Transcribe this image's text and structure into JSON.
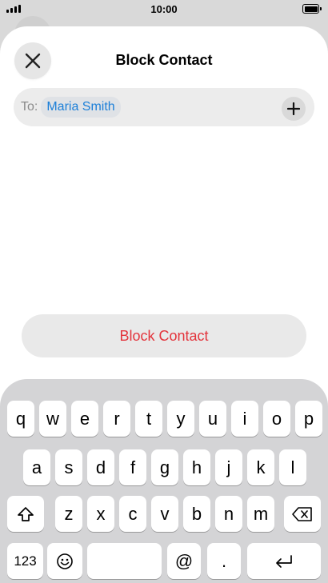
{
  "status_bar": {
    "time": "10:00"
  },
  "header": {
    "title": "Block Contact"
  },
  "compose": {
    "to_label": "To:",
    "recipient": "Maria Smith"
  },
  "action": {
    "block_label": "Block Contact",
    "color": "#e3343c"
  },
  "keyboard": {
    "row1": [
      "q",
      "w",
      "e",
      "r",
      "t",
      "y",
      "u",
      "i",
      "o",
      "p"
    ],
    "row2": [
      "a",
      "s",
      "d",
      "f",
      "g",
      "h",
      "j",
      "k",
      "l"
    ],
    "row3": [
      "z",
      "x",
      "c",
      "v",
      "b",
      "n",
      "m"
    ],
    "numbers_label": "123",
    "at_label": "@",
    "period_label": ".",
    "icons": {
      "shift": "shift-icon",
      "delete": "delete-icon",
      "emoji": "emoji-icon",
      "return": "return-icon"
    }
  }
}
